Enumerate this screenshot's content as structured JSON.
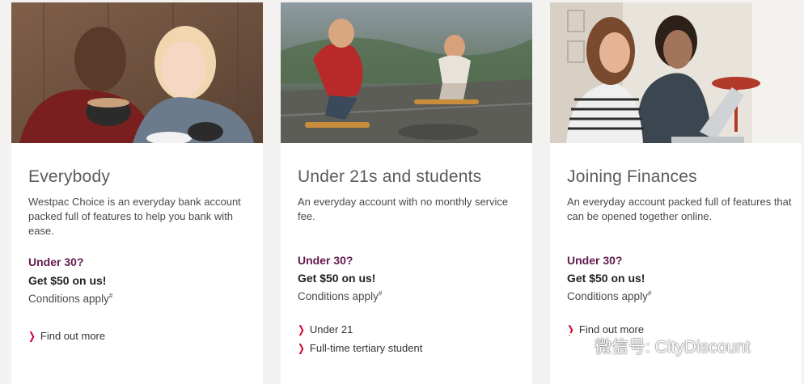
{
  "cards": [
    {
      "title": "Everybody",
      "description": "Westpac Choice is an everyday bank account packed full of features to help you bank with ease.",
      "promo_question": "Under 30?",
      "promo_offer": "Get $50 on us!",
      "conditions": "Conditions apply",
      "conditions_mark": "#",
      "links": [
        "Find out more"
      ]
    },
    {
      "title": "Under 21s and students",
      "description": "An everyday account with no monthly service fee.",
      "promo_question": "Under 30?",
      "promo_offer": "Get $50 on us!",
      "conditions": "Conditions apply",
      "conditions_mark": "#",
      "links": [
        "Under 21",
        "Full-time tertiary student"
      ]
    },
    {
      "title": "Joining Finances",
      "description": "An everyday account packed full of features that can be opened together online.",
      "promo_question": "Under 30?",
      "promo_offer": "Get $50 on us!",
      "conditions": "Conditions apply",
      "conditions_mark": "#",
      "links": [
        "Find out more"
      ]
    }
  ],
  "watermark": {
    "text": "微信号: CityDiscount"
  },
  "colors": {
    "accent_purple": "#621a4b",
    "chevron_red": "#d5002b",
    "background": "#f3f2f0"
  },
  "icons": {
    "link_chevron": "chevron-right-icon"
  }
}
